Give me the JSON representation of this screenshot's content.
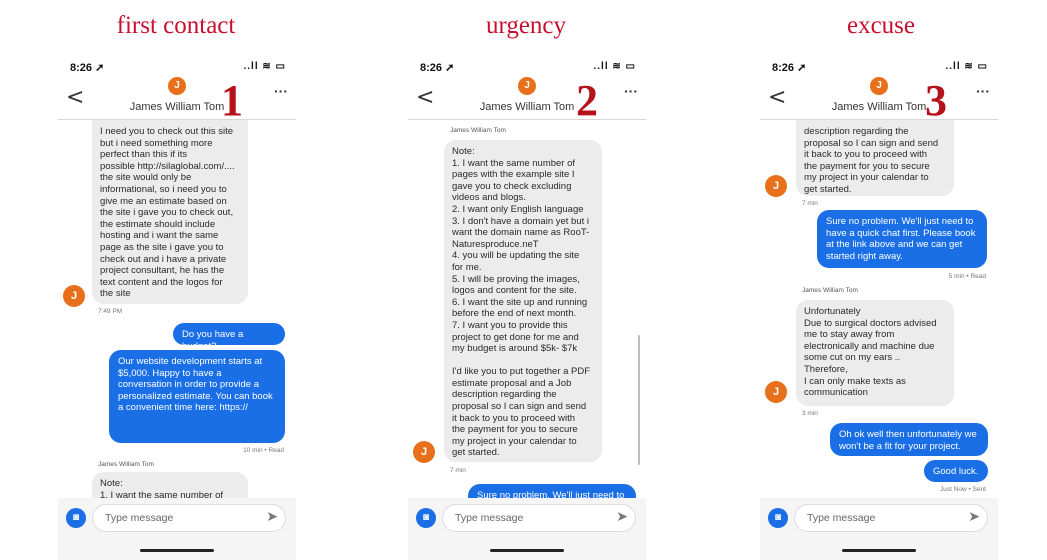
{
  "panels": [
    {
      "title": "first contact",
      "number": "1",
      "status": {
        "time": "8:26 ➚",
        "icons": "..ll ≋ ▭"
      },
      "contact": {
        "initial": "J",
        "name": "James William Tom"
      },
      "back_label": "<",
      "more_label": "···",
      "messages": {
        "in1": "I need you to check out this site\nbut i need something more\nperfect than this if its\npossible http://silaglobal.com/....\nthe site would only be\ninformational, so i need you to\ngive me an estimate based on\nthe site i gave you to check out,\nthe estimate should include\nhosting and i want the same\npage as the site i gave you to\ncheck out and i have a private\nproject consultant, he has the\ntext content and the logos for\nthe site",
        "in1_time": "7:49 PM",
        "out1": "Do you have a budget?",
        "out2": "Our website development starts at\n$5,000. Happy to have a\nconversation in order to provide a\npersonalized estimate. You can book\na convenient time here: https://",
        "out2_meta": "10 min • Read",
        "sender2": "James William Tom",
        "in2": "Note:\n1. I want the same number of"
      },
      "composer": {
        "placeholder": "Type message",
        "send": "➤",
        "camera": "◙"
      }
    },
    {
      "title": "urgency",
      "number": "2",
      "status": {
        "time": "8:26 ➚",
        "icons": "..ll ≋ ▭"
      },
      "contact": {
        "initial": "J",
        "name": "James William Tom"
      },
      "back_label": "<",
      "more_label": "···",
      "messages": {
        "sender": "James William Tom",
        "in1": "Note:\n1. I want the same number of\npages with the example site I\ngave you to check excluding\nvideos and blogs.\n2. I want only English language\n3. I don't have a domain yet but i\nwant the domain name as RooT-\nNaturesproduce.neT\n4. you will be updating the site\nfor me.\n5. I will be proving the images,\nlogos and content for the site.\n6. I want the site up and running\nbefore the end of next  month.\n7. I want you to provide this\nproject to get done for me and\nmy budget is around $5k- $7k\n\nI'd like you to put together a PDF\nestimate proposal and a Job\ndescription regarding the\nproposal so I can sign and send\nit back to you to proceed with\nthe payment for you to secure\nmy project in your calendar to\nget started.",
        "in1_time": "7 min",
        "out1": "Sure no problem. We'll just need to"
      },
      "composer": {
        "placeholder": "Type message",
        "send": "➤",
        "camera": "◙"
      }
    },
    {
      "title": "excuse",
      "number": "3",
      "status": {
        "time": "8:26 ➚",
        "icons": "..ll ≋ ▭"
      },
      "contact": {
        "initial": "J",
        "name": "James William Tom"
      },
      "back_label": "<",
      "more_label": "···",
      "messages": {
        "in1": "description regarding the\nproposal so I can sign and send\nit back to you to proceed with\nthe payment for you to secure\nmy project in your calendar to\nget started.",
        "in1_time": "7 min",
        "out1": "Sure no problem. We'll just need to\nhave a quick chat first. Please book\nat the link above and we can get\nstarted right away.",
        "out1_meta": "5 min • Read",
        "sender2": "James William Tom",
        "in2": "Unfortunately\nDue to surgical doctors advised\nme to stay away from\nelectronically and machine due\nsome cut on my ears ..\nTherefore,\n I can only make texts as\ncommunication",
        "in2_time": "3 min",
        "out2": "Oh ok well then unfortunately we\nwon't be a fit for your project.",
        "out3": "Good luck.",
        "out3_meta": "Just Now • Sent"
      },
      "composer": {
        "placeholder": "Type message",
        "send": "➤",
        "camera": "◙"
      }
    }
  ]
}
